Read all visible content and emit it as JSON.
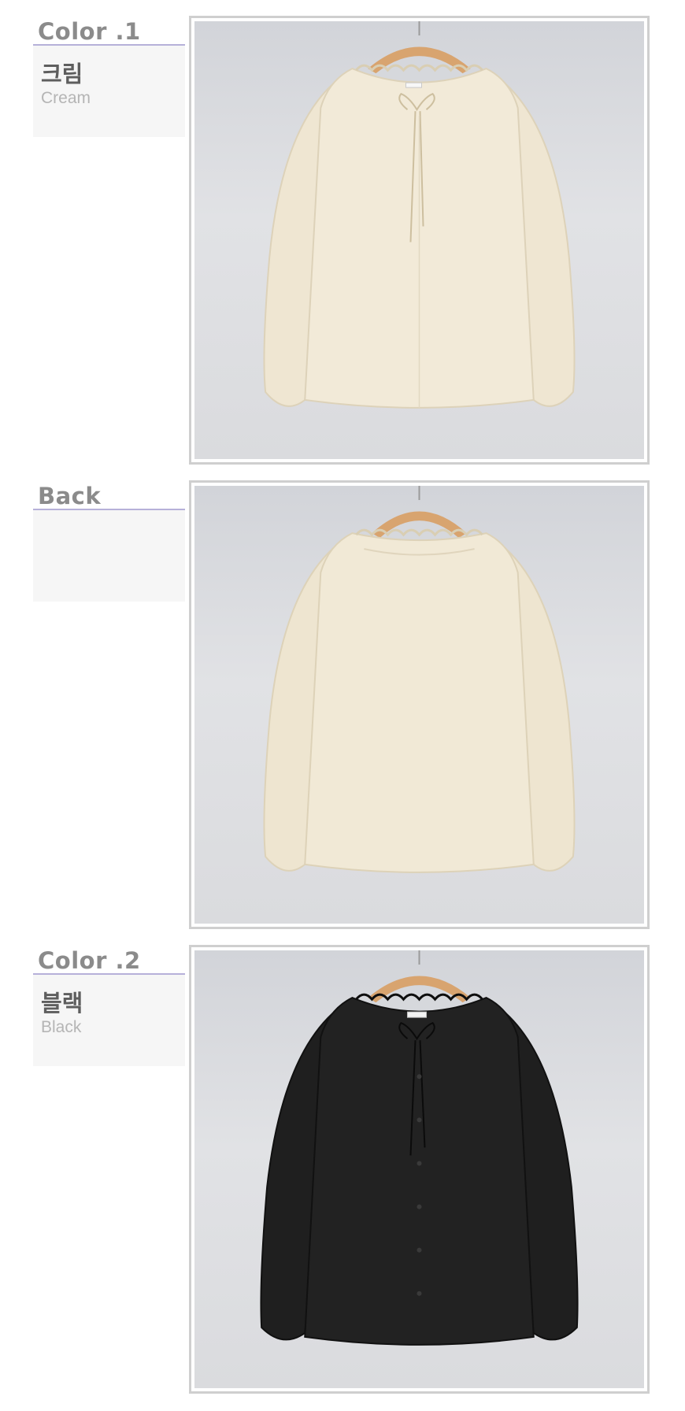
{
  "sections": [
    {
      "title": "Color .1",
      "name_ko": "크림",
      "name_en": "Cream",
      "photo": {
        "view": "front",
        "garment_color": "#f2ead8",
        "shade_color": "#ddd2b9",
        "tag_text": ""
      }
    },
    {
      "title": "Back",
      "name_ko": "",
      "name_en": "",
      "photo": {
        "view": "back",
        "garment_color": "#f1e9d6",
        "shade_color": "#ddd2b8"
      }
    },
    {
      "title": "Color .2",
      "name_ko": "블랙",
      "name_en": "Black",
      "photo": {
        "view": "front",
        "garment_color": "#222222",
        "shade_color": "#111111",
        "tag_text": ""
      }
    }
  ],
  "colors": {
    "label_title": "#8b8b8b",
    "underline": "#b6b1d9",
    "panel_bg": "#f6f6f6",
    "frame_border": "#cfcfcf",
    "hanger": "#d8a46f"
  }
}
